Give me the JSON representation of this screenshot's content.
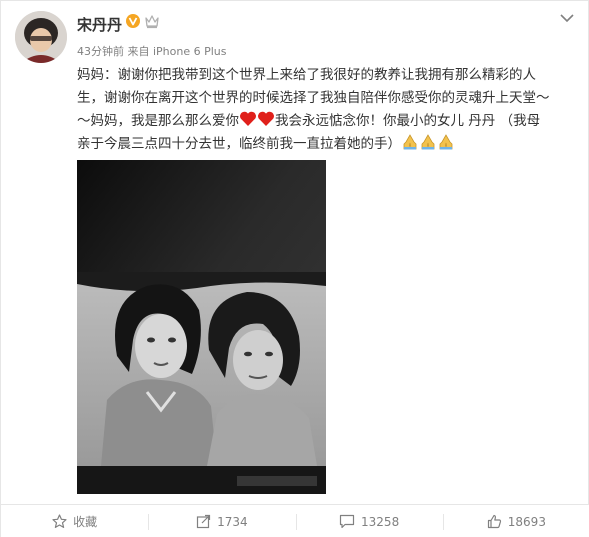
{
  "post": {
    "username": "宋丹丹",
    "meta": "43分钟前 来自 iPhone 6 Plus",
    "text": {
      "line1": "妈妈：谢谢你把我带到这个世界上来给了我很好的教养让我拥有那么精彩的人",
      "line2": "生，谢谢你在离开这个世界的时候选择了我独自陪伴你感受你的灵魂升上天堂～",
      "line3a": "～妈妈，我是那么那么爱你",
      "line3b": "我会永远惦念你！你最小的女儿  丹丹  （我母",
      "line4": "亲于今晨三点四十分去世，临终前我一直拉着她的手）"
    }
  },
  "actions": {
    "favorite": "收藏",
    "repost_count": "1734",
    "comment_count": "13258",
    "like_count": "18693"
  },
  "colors": {
    "verified": "#f5a623",
    "heart": "#e0201b",
    "meta": "#808080"
  },
  "icons": [
    "verified-icon",
    "crown-icon",
    "chevron-down-icon",
    "heart-icon",
    "praying-hands-icon",
    "star-icon",
    "share-icon",
    "comment-icon",
    "thumbs-up-icon"
  ]
}
